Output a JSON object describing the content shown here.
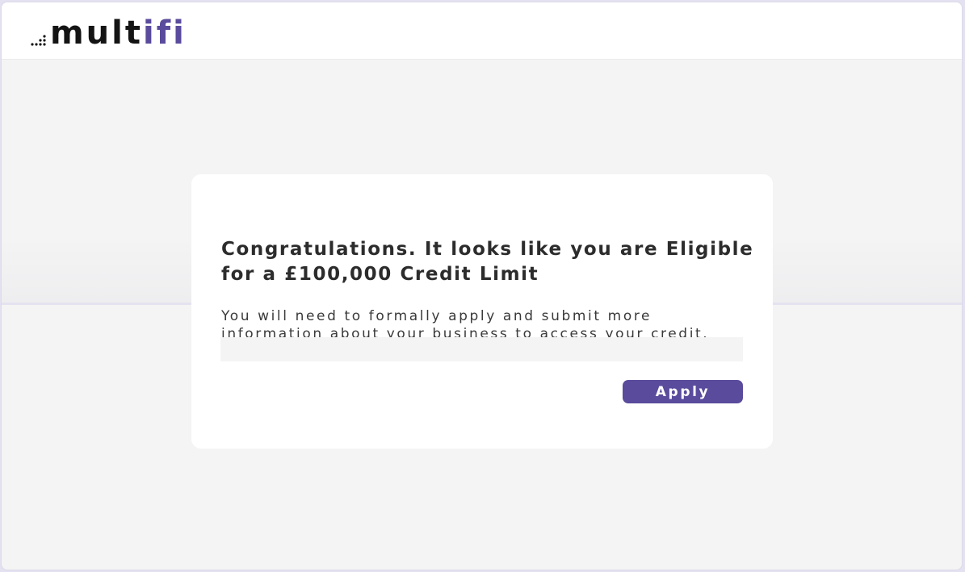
{
  "brand": {
    "name_main": "mult",
    "name_accent": "ifi",
    "logo_icon": "dots-logo-icon",
    "accent_color": "#5a4b9c"
  },
  "eligibility": {
    "title": "Congratulations. It looks like you are Eligible for a £100,000 Credit Limit",
    "body": "You will need to formally apply and submit more information about your business to access your credit.",
    "apply_label": "Apply"
  },
  "colors": {
    "background": "#f4f4f4",
    "card": "#ffffff",
    "button": "#5a4b9c",
    "text": "#2c2c2c"
  }
}
